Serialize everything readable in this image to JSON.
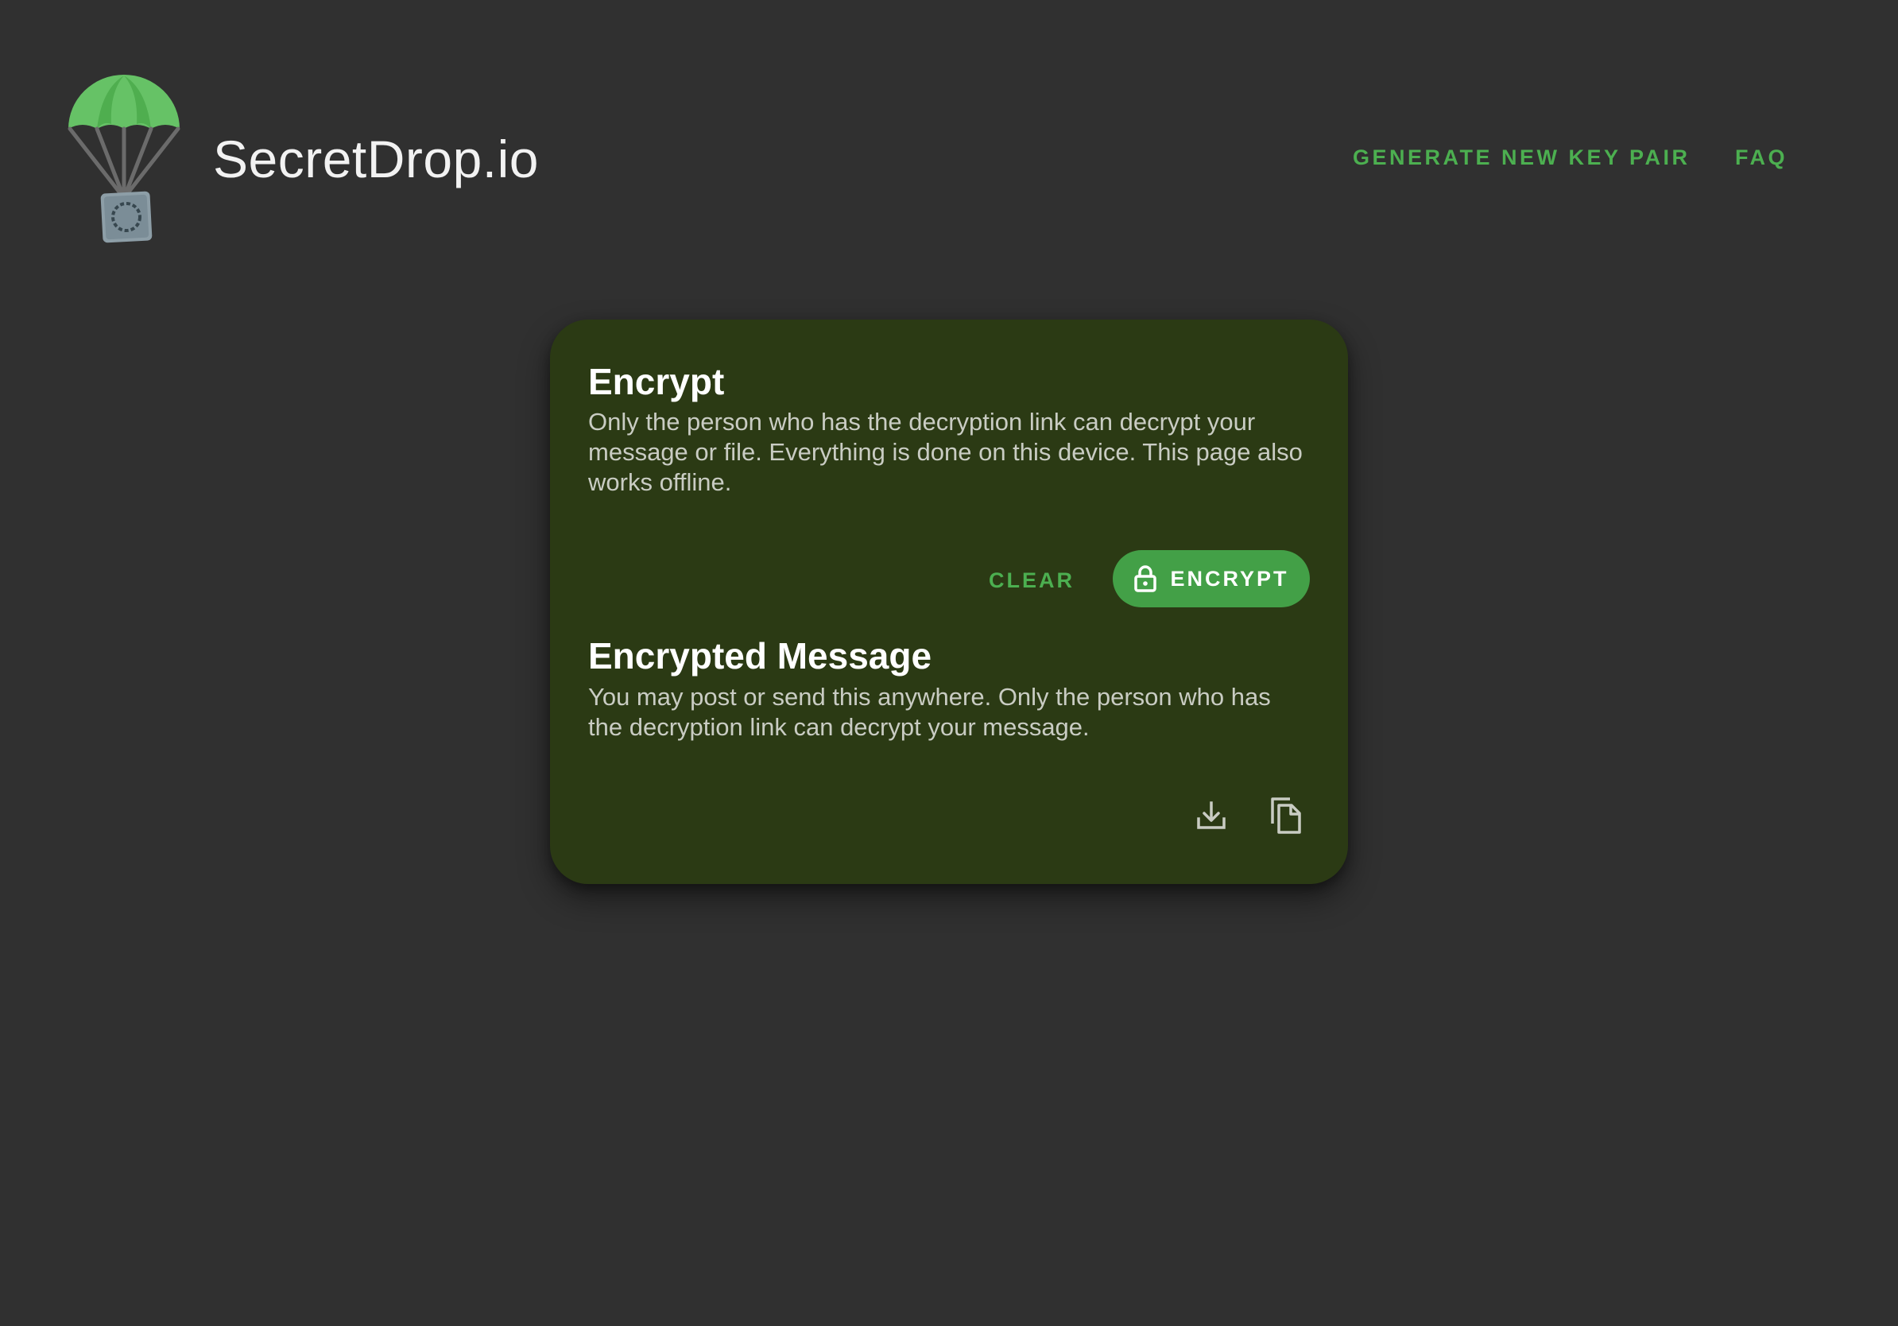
{
  "header": {
    "brand": "SecretDrop.io",
    "nav": {
      "generate_key_pair": "GENERATE NEW KEY PAIR",
      "faq": "FAQ"
    },
    "logo_icon": "parachute-safe-icon"
  },
  "encrypt_section": {
    "title": "Encrypt",
    "description": "Only the person who has the decryption link can decrypt your message or file. Everything is done on this device. This page also works offline.",
    "clear_label": "CLEAR",
    "encrypt_label": "ENCRYPT",
    "encrypt_icon": "lock-icon"
  },
  "encrypted_message_section": {
    "title": "Encrypted Message",
    "description": "You may post or send this anywhere. Only the person who has the decryption link can decrypt your message.",
    "actions": [
      "download-icon",
      "copy-icon"
    ]
  },
  "colors": {
    "background": "#303030",
    "card": "#2b3a14",
    "accent": "#4caf50",
    "button": "#43a047",
    "text": "#ffffff",
    "muted_text": "#c9ccc3"
  }
}
